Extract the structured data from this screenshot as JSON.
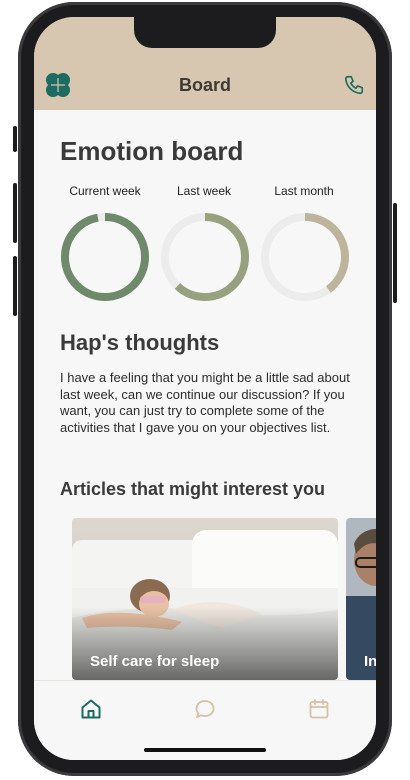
{
  "header": {
    "title": "Board"
  },
  "board": {
    "title": "Emotion board",
    "periods": [
      {
        "label": "Current week",
        "value": 0.97,
        "color": "#6f8a6a"
      },
      {
        "label": "Last week",
        "value": 0.62,
        "color": "#97a17e"
      },
      {
        "label": "Last month",
        "value": 0.4,
        "color": "#bdb49b"
      }
    ]
  },
  "thoughts": {
    "title": "Hap's thoughts",
    "text": "I have a feeling that you might be a little sad about last week, can we continue our discussion? If you want, you can just try to complete some of the activities that I gave you on your objectives list."
  },
  "articles": {
    "title": "Articles that might interest you",
    "items": [
      {
        "label": "Self care for sleep"
      },
      {
        "label": "In"
      }
    ]
  },
  "colors": {
    "accent": "#1d6b63",
    "header": "#d7c7b1",
    "tab_inactive": "#d3c2a4"
  }
}
